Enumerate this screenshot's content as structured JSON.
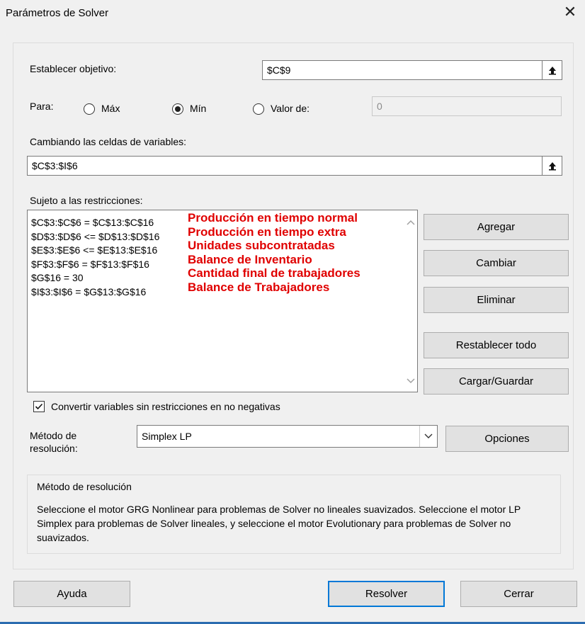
{
  "dialog": {
    "title": "Parámetros de Solver",
    "close_symbol": "✕"
  },
  "objective": {
    "label": "Establecer objetivo:",
    "value": "$C$9"
  },
  "to": {
    "label": "Para:",
    "options": [
      {
        "label": "Máx",
        "selected": false
      },
      {
        "label": "Mín",
        "selected": true
      },
      {
        "label": "Valor de:",
        "selected": false
      }
    ],
    "value_of": "0"
  },
  "variables": {
    "label": "Cambiando las celdas de variables:",
    "value": "$C$3:$I$6"
  },
  "constraints": {
    "label": "Sujeto a las restricciones:",
    "items": [
      "$C$3:$C$6 = $C$13:$C$16",
      "$D$3:$D$6 <= $D$13:$D$16",
      "$E$3:$E$6 <= $E$13:$E$16",
      "$F$3:$F$6 = $F$13:$F$16",
      "$G$16 = 30",
      "$I$3:$I$6 = $G$13:$G$16"
    ],
    "annotations": [
      "Producción en tiempo normal",
      "Producción en tiempo extra",
      "Unidades subcontratadas",
      "Balance de Inventario",
      "Cantidad final de trabajadores",
      "Balance de Trabajadores"
    ],
    "annotation_color": "#e00000"
  },
  "side_buttons": {
    "add": "Agregar",
    "change": "Cambiar",
    "delete": "Eliminar",
    "reset_all": "Restablecer todo",
    "load_save": "Cargar/Guardar"
  },
  "nonneg": {
    "label": "Convertir variables sin restricciones en no negativas",
    "checked": true
  },
  "method": {
    "label_line1": "Método de",
    "label_line2": "resolución:",
    "selected": "Simplex LP",
    "options_button": "Opciones"
  },
  "method_group": {
    "title": "Método de resolución",
    "description": "Seleccione el motor GRG Nonlinear para problemas de Solver no lineales suavizados. Seleccione el motor LP Simplex para problemas de Solver lineales, y seleccione el motor Evolutionary para problemas de Solver no suavizados."
  },
  "footer": {
    "help": "Ayuda",
    "solve": "Resolver",
    "close": "Cerrar"
  },
  "icons": {
    "collapse": "collapse-dialog-icon",
    "check": "checkmark-icon",
    "dropdown": "chevron-down-icon"
  },
  "colors": {
    "accent": "#0078d7",
    "annotation": "#e00000"
  }
}
